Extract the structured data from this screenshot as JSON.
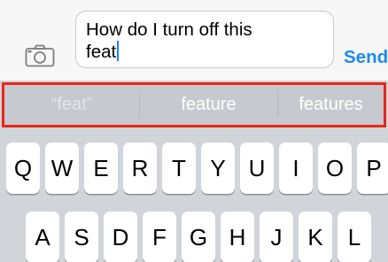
{
  "input_bar": {
    "text_line1": "How do I turn off this",
    "text_line2": "feat",
    "send_label": "Send",
    "camera_icon": "camera-icon"
  },
  "suggestions": {
    "items": [
      "“feat”",
      "feature",
      "features"
    ],
    "highlight_color": "#e8271b"
  },
  "keyboard": {
    "row1": [
      "Q",
      "W",
      "E",
      "R",
      "T",
      "Y",
      "U",
      "I",
      "O",
      "P"
    ],
    "row2": [
      "A",
      "S",
      "D",
      "F",
      "G",
      "H",
      "J",
      "K",
      "L"
    ]
  },
  "colors": {
    "accent": "#1e88f2",
    "keyboard_bg": "#d1d4d9",
    "key_bg": "#ffffff"
  }
}
